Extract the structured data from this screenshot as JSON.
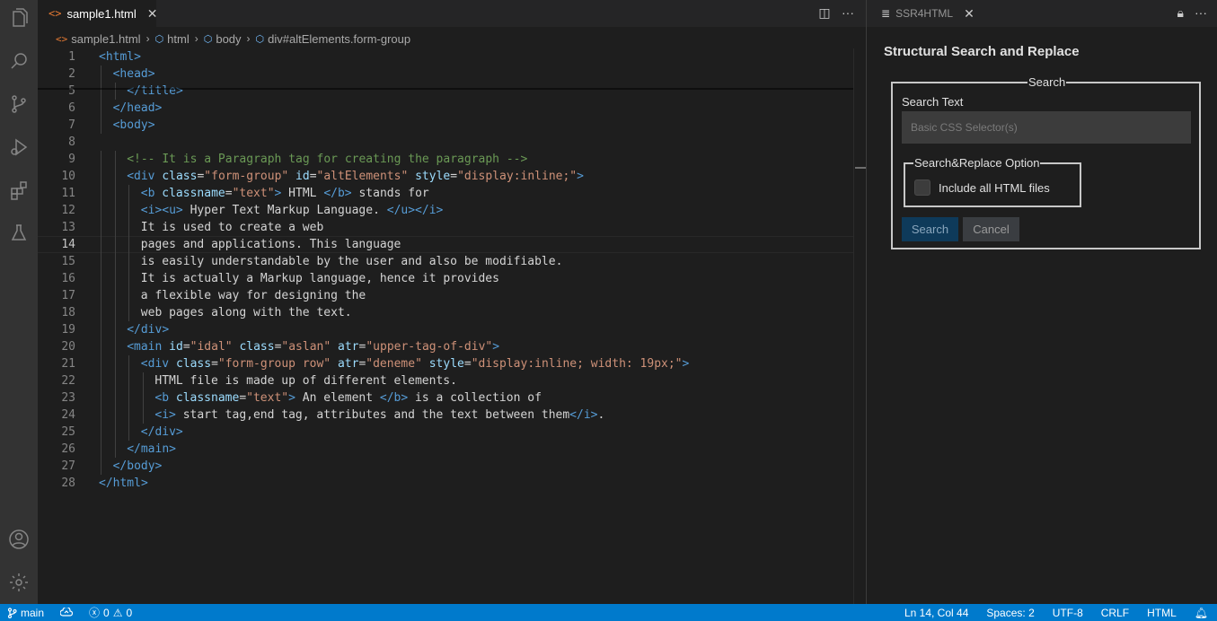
{
  "editor": {
    "tab": {
      "icon": "<>",
      "label": "sample1.html"
    },
    "breadcrumb": [
      "sample1.html",
      "html",
      "body",
      "div#altElements.form-group"
    ],
    "active_line": 14,
    "lines": [
      {
        "n": "1",
        "indent": 0,
        "parts": [
          [
            "tag",
            "<html>"
          ]
        ]
      },
      {
        "n": "2",
        "indent": 1,
        "parts": [
          [
            "tag",
            "<head>"
          ]
        ]
      },
      {
        "n": "5",
        "indent": 2,
        "parts": [
          [
            "tag",
            "</title>"
          ]
        ]
      },
      {
        "n": "6",
        "indent": 1,
        "parts": [
          [
            "tag",
            "</head>"
          ]
        ]
      },
      {
        "n": "7",
        "indent": 1,
        "parts": [
          [
            "tag",
            "<body>"
          ]
        ]
      },
      {
        "n": "8",
        "indent": 0,
        "parts": []
      },
      {
        "n": "9",
        "indent": 2,
        "parts": [
          [
            "cmt",
            "<!-- It is a Paragraph tag for creating the paragraph -->"
          ]
        ]
      },
      {
        "n": "10",
        "indent": 2,
        "parts": [
          [
            "tag",
            "<div "
          ],
          [
            "attr",
            "class"
          ],
          [
            "plain",
            "="
          ],
          [
            "str",
            "\"form-group\""
          ],
          [
            "plain",
            " "
          ],
          [
            "attr",
            "id"
          ],
          [
            "plain",
            "="
          ],
          [
            "str",
            "\"altElements\""
          ],
          [
            "plain",
            " "
          ],
          [
            "attr",
            "style"
          ],
          [
            "plain",
            "="
          ],
          [
            "str",
            "\"display:inline;\""
          ],
          [
            "tag",
            ">"
          ]
        ]
      },
      {
        "n": "11",
        "indent": 3,
        "parts": [
          [
            "tag",
            "<b "
          ],
          [
            "attr",
            "classname"
          ],
          [
            "plain",
            "="
          ],
          [
            "str",
            "\"text\""
          ],
          [
            "tag",
            ">"
          ],
          [
            "plain",
            " HTML "
          ],
          [
            "tag",
            "</b>"
          ],
          [
            "plain",
            " stands for"
          ]
        ]
      },
      {
        "n": "12",
        "indent": 3,
        "parts": [
          [
            "tag",
            "<i><u>"
          ],
          [
            "plain",
            " Hyper Text Markup Language. "
          ],
          [
            "tag",
            "</u></i>"
          ]
        ]
      },
      {
        "n": "13",
        "indent": 3,
        "parts": [
          [
            "plain",
            "It is used to create a web"
          ]
        ]
      },
      {
        "n": "14",
        "indent": 3,
        "parts": [
          [
            "plain",
            "pages and applications. This language"
          ]
        ]
      },
      {
        "n": "15",
        "indent": 3,
        "parts": [
          [
            "plain",
            "is easily understandable by the user and also be modifiable."
          ]
        ]
      },
      {
        "n": "16",
        "indent": 3,
        "parts": [
          [
            "plain",
            "It is actually a Markup language, hence it provides"
          ]
        ]
      },
      {
        "n": "17",
        "indent": 3,
        "parts": [
          [
            "plain",
            "a flexible way for designing the"
          ]
        ]
      },
      {
        "n": "18",
        "indent": 3,
        "parts": [
          [
            "plain",
            "web pages along with the text."
          ]
        ]
      },
      {
        "n": "19",
        "indent": 2,
        "parts": [
          [
            "tag",
            "</div>"
          ]
        ]
      },
      {
        "n": "20",
        "indent": 2,
        "parts": [
          [
            "tag",
            "<main "
          ],
          [
            "attr",
            "id"
          ],
          [
            "plain",
            "="
          ],
          [
            "str",
            "\"idal\""
          ],
          [
            "plain",
            " "
          ],
          [
            "attr",
            "class"
          ],
          [
            "plain",
            "="
          ],
          [
            "str",
            "\"aslan\""
          ],
          [
            "plain",
            " "
          ],
          [
            "attr",
            "atr"
          ],
          [
            "plain",
            "="
          ],
          [
            "str",
            "\"upper-tag-of-div\""
          ],
          [
            "tag",
            ">"
          ]
        ]
      },
      {
        "n": "21",
        "indent": 3,
        "parts": [
          [
            "tag",
            "<div "
          ],
          [
            "attr",
            "class"
          ],
          [
            "plain",
            "="
          ],
          [
            "str",
            "\"form-group row\""
          ],
          [
            "plain",
            " "
          ],
          [
            "attr",
            "atr"
          ],
          [
            "plain",
            "="
          ],
          [
            "str",
            "\"deneme\""
          ],
          [
            "plain",
            " "
          ],
          [
            "attr",
            "style"
          ],
          [
            "plain",
            "="
          ],
          [
            "str",
            "\"display:inline; width: 19px;\""
          ],
          [
            "tag",
            ">"
          ]
        ]
      },
      {
        "n": "22",
        "indent": 4,
        "parts": [
          [
            "plain",
            "HTML file is made up of different elements."
          ]
        ]
      },
      {
        "n": "23",
        "indent": 4,
        "parts": [
          [
            "tag",
            "<b "
          ],
          [
            "attr",
            "classname"
          ],
          [
            "plain",
            "="
          ],
          [
            "str",
            "\"text\""
          ],
          [
            "tag",
            ">"
          ],
          [
            "plain",
            " An element "
          ],
          [
            "tag",
            "</b>"
          ],
          [
            "plain",
            " is a collection of"
          ]
        ]
      },
      {
        "n": "24",
        "indent": 4,
        "parts": [
          [
            "tag",
            "<i>"
          ],
          [
            "plain",
            " start tag,end tag, attributes and the text between them"
          ],
          [
            "tag",
            "</i>"
          ],
          [
            "plain",
            "."
          ]
        ]
      },
      {
        "n": "25",
        "indent": 3,
        "parts": [
          [
            "tag",
            "</div>"
          ]
        ]
      },
      {
        "n": "26",
        "indent": 2,
        "parts": [
          [
            "tag",
            "</main>"
          ]
        ]
      },
      {
        "n": "27",
        "indent": 1,
        "parts": [
          [
            "tag",
            "</body>"
          ]
        ]
      },
      {
        "n": "28",
        "indent": 0,
        "parts": [
          [
            "tag",
            "</html>"
          ]
        ]
      }
    ]
  },
  "panel": {
    "tab_label": "SSR4HTML",
    "title": "Structural Search and Replace",
    "search_legend": "Search",
    "search_text_label": "Search Text",
    "search_placeholder": "Basic CSS Selector(s)",
    "option_legend": "Search&Replace Option",
    "include_all_label": "Include all HTML files",
    "include_all_checked": false,
    "search_button": "Search",
    "cancel_button": "Cancel"
  },
  "statusbar": {
    "branch": "main",
    "errors": "0",
    "warnings": "0",
    "position": "Ln 14, Col 44",
    "spaces": "Spaces: 2",
    "encoding": "UTF-8",
    "eol": "CRLF",
    "language": "HTML"
  },
  "colors": {
    "statusbar": "#007acc",
    "activitybar": "#333333",
    "editor_bg": "#1e1e1e",
    "tag": "#569cd6",
    "attr": "#9cdcfe",
    "string": "#ce9178",
    "comment": "#6a9955"
  },
  "icons": {
    "activity": [
      "explorer-icon",
      "search-icon",
      "source-control-icon",
      "run-debug-icon",
      "extensions-icon",
      "testing-icon",
      "account-icon",
      "manage-gear-icon"
    ]
  }
}
